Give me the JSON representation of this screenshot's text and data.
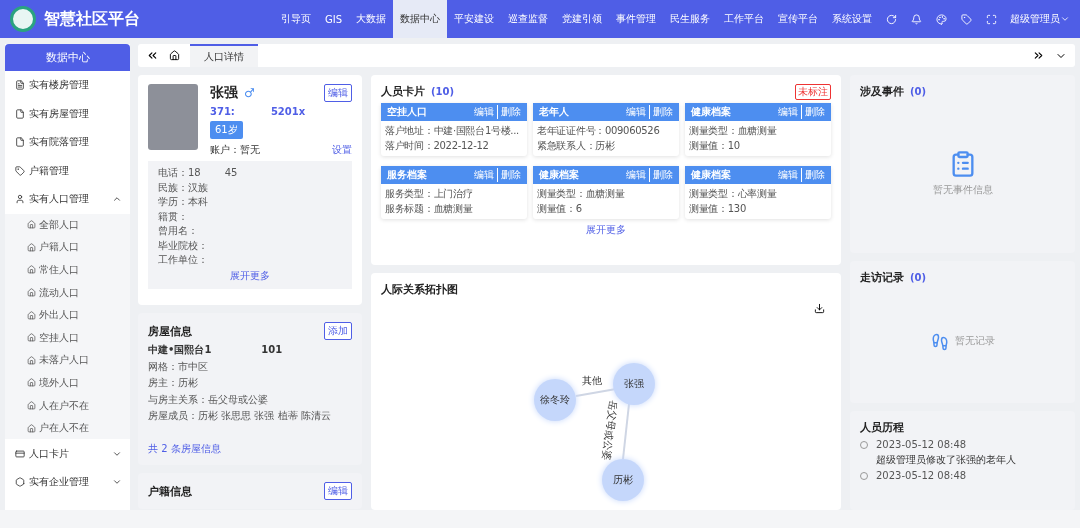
{
  "app": {
    "title": "智慧社区平台",
    "nav": [
      {
        "label": "引导页",
        "selected": false
      },
      {
        "label": "GIS",
        "selected": false
      },
      {
        "label": "大数据",
        "selected": false
      },
      {
        "label": "数据中心",
        "selected": true
      },
      {
        "label": "平安建设",
        "selected": false
      },
      {
        "label": "巡查监督",
        "selected": false
      },
      {
        "label": "党建引领",
        "selected": false
      },
      {
        "label": "事件管理",
        "selected": false
      },
      {
        "label": "民生服务",
        "selected": false
      },
      {
        "label": "工作平台",
        "selected": false
      },
      {
        "label": "宣传平台",
        "selected": false
      },
      {
        "label": "系统设置",
        "selected": false
      }
    ],
    "user": "超级管理员"
  },
  "sidebar": {
    "title": "数据中心",
    "items": [
      {
        "label": "实有楼房管理",
        "kind": "link"
      },
      {
        "label": "实有房屋管理",
        "kind": "link"
      },
      {
        "label": "实有院落管理",
        "kind": "link"
      },
      {
        "label": "户籍管理",
        "kind": "link"
      },
      {
        "label": "实有人口管理",
        "kind": "group",
        "expanded": true,
        "children": [
          {
            "label": "全部人口"
          },
          {
            "label": "户籍人口"
          },
          {
            "label": "常住人口"
          },
          {
            "label": "流动人口"
          },
          {
            "label": "外出人口"
          },
          {
            "label": "空挂人口"
          },
          {
            "label": "未落户人口"
          },
          {
            "label": "境外人口"
          },
          {
            "label": "人在户不在"
          },
          {
            "label": "户在人不在"
          }
        ]
      },
      {
        "label": "人口卡片",
        "kind": "group",
        "expanded": false
      },
      {
        "label": "实有企业管理",
        "kind": "group",
        "expanded": false
      }
    ]
  },
  "tabs": [
    {
      "label": "人口详情",
      "selected": true
    }
  ],
  "profile": {
    "name": "张强",
    "gender": "♂",
    "edit": "编辑",
    "id_start": "371:",
    "id_end": "5201x",
    "age": "61岁",
    "account": "账户：暂无",
    "settings": "设置",
    "phone_start": "电话：18",
    "phone_end": "45",
    "fields": [
      "民族：汉族",
      "学历：本科",
      "籍贯：",
      "曾用名：",
      "毕业院校：",
      "工作单位："
    ],
    "more": "展开更多"
  },
  "house": {
    "title": "房屋信息",
    "add": "添加",
    "address": "中建•国熙台1",
    "room": "101",
    "fields": [
      "网格：市中区",
      "房主：历彬",
      "与房主关系：岳父母或公婆",
      "房屋成员：历彬 张思思 张强 植蒂 陈清云"
    ],
    "count": "共 2 条房屋信息"
  },
  "hukou": {
    "title": "户籍信息",
    "edit": "编辑"
  },
  "person_cards": {
    "title": "人员卡片",
    "count": "(10)",
    "tag": "未标注",
    "more": "展开更多",
    "cards": [
      {
        "title": "空挂人口",
        "edit": "编辑",
        "delete": "删除",
        "lines": [
          "落户地址：中建·国熙台1号楼...",
          "落户时间：2022-12-12"
        ]
      },
      {
        "title": "老年人",
        "edit": "编辑",
        "delete": "删除",
        "lines": [
          "老年证证件号：009060526",
          "紧急联系人：历彬"
        ]
      },
      {
        "title": "健康档案",
        "edit": "编辑",
        "delete": "删除",
        "lines": [
          "测量类型：血糖测量",
          "测量值：10"
        ]
      },
      {
        "title": "服务档案",
        "edit": "编辑",
        "delete": "删除",
        "lines": [
          "服务类型：上门治疗",
          "服务标题：血糖测量"
        ]
      },
      {
        "title": "健康档案",
        "edit": "编辑",
        "delete": "删除",
        "lines": [
          "测量类型：血糖测量",
          "测量值：6"
        ]
      },
      {
        "title": "健康档案",
        "edit": "编辑",
        "delete": "删除",
        "lines": [
          "测量类型：心率测量",
          "测量值：130"
        ]
      }
    ]
  },
  "relations": {
    "title": "人际关系拓扑图",
    "nodes": [
      "徐冬玲",
      "张强",
      "历彬"
    ],
    "edges": [
      "其他",
      "岳父母或公婆"
    ]
  },
  "events": {
    "title": "涉及事件",
    "count": "(0)",
    "empty": "暂无事件信息"
  },
  "visits": {
    "title": "走访记录",
    "count": "(0)",
    "empty": "暂无记录"
  },
  "history": {
    "title": "人员历程",
    "entries": [
      {
        "time": "2023-05-12 08:48",
        "text": "超级管理员修改了张强的老年人"
      },
      {
        "time": "2023-05-12 08:48"
      }
    ]
  }
}
